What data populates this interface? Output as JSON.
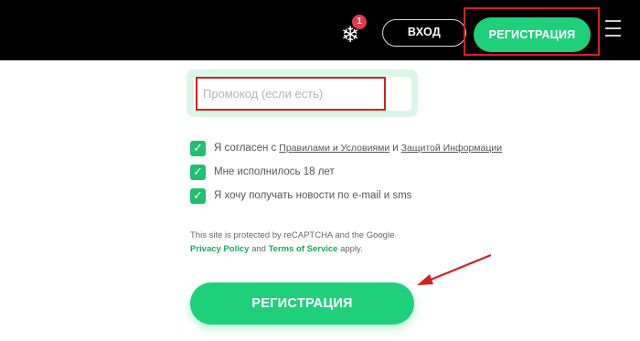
{
  "header": {
    "notification_count": "1",
    "notification_icon": "snowflake-icon",
    "login_label": "ВХОД",
    "register_label": "РЕГИСТРАЦИЯ",
    "menu_icon": "hamburger-menu-icon"
  },
  "form": {
    "promo_placeholder": "Промокод (если есть)",
    "promo_value": "",
    "agreements": {
      "terms_prefix": "Я согласен с",
      "terms_link": "Правилами и Условиями",
      "terms_and": "и",
      "privacy_link": "Защитой Информации",
      "age": "Мне исполнилось 18 лет",
      "news": "Я хочу получать новости по e-mail и sms"
    },
    "recaptcha": {
      "line1": "This site is protected by reCAPTCHA and the Google",
      "privacy_policy": "Privacy Policy",
      "and": "and",
      "terms": "Terms of Service",
      "apply": "apply."
    },
    "submit_label": "РЕГИСТРАЦИЯ"
  },
  "colors": {
    "accent_green": "#1fd07a",
    "annotation_red": "#d52020",
    "header_bg": "#000000"
  }
}
